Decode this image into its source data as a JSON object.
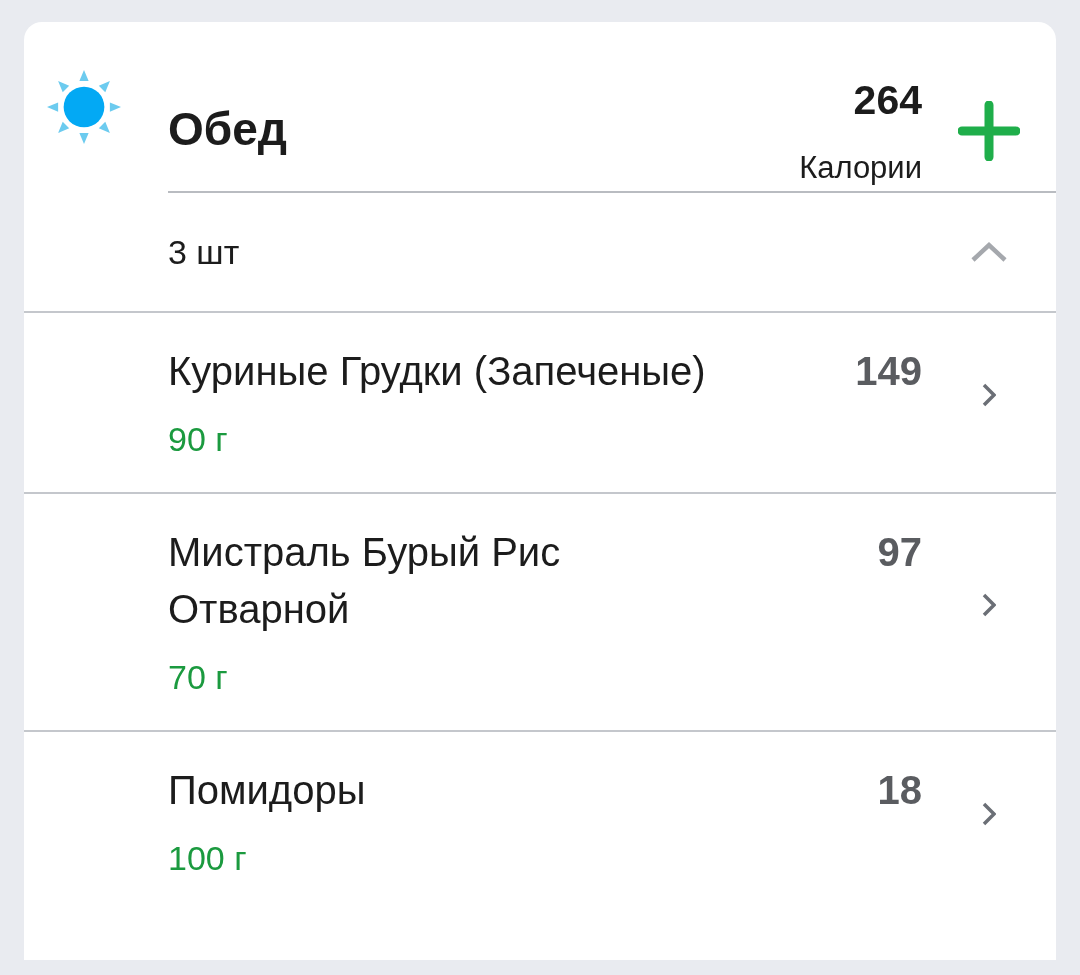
{
  "meal": {
    "title": "Обед",
    "calories": "264",
    "calories_label": "Калории"
  },
  "summary": {
    "count": "3 шт",
    "expanded": true
  },
  "items": [
    {
      "name": "Куриные Грудки (Запеченые)",
      "amount": "90 г",
      "calories": "149"
    },
    {
      "name": "Мистраль Бурый Рис Отварной",
      "amount": "70 г",
      "calories": "97"
    },
    {
      "name": "Помидоры",
      "amount": "100 г",
      "calories": "18"
    }
  ]
}
